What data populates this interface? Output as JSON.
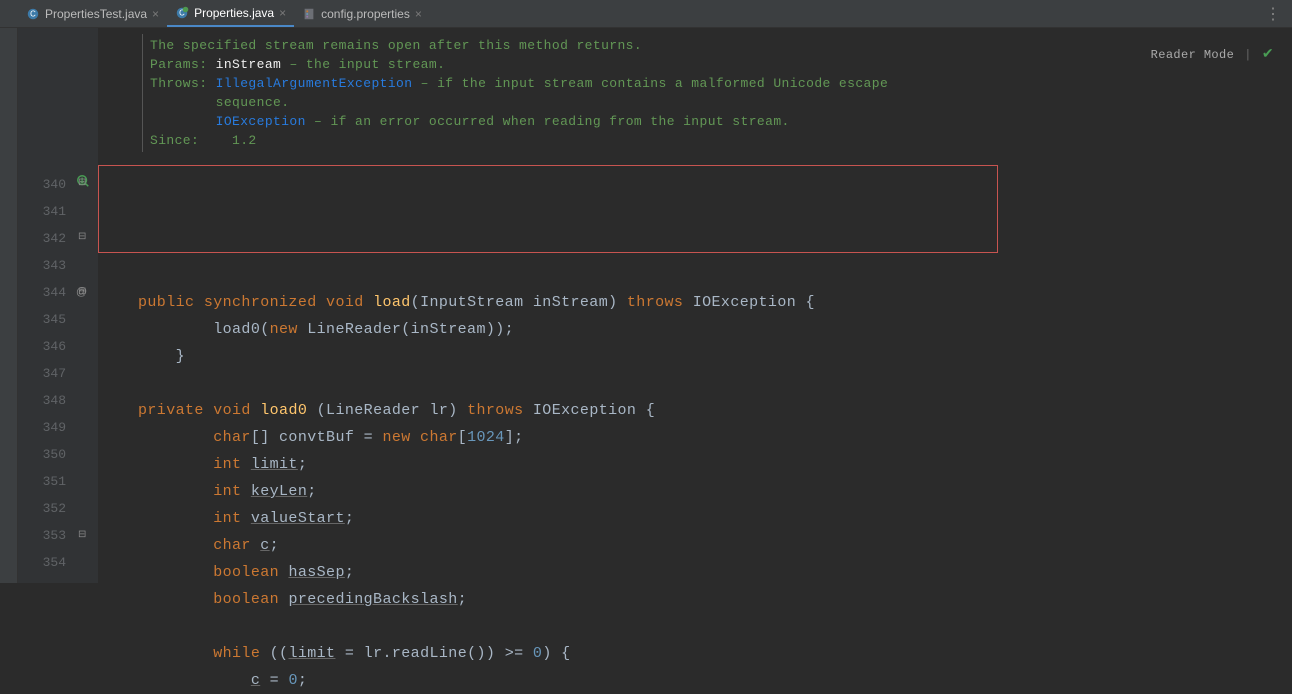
{
  "tabs": [
    {
      "label": "PropertiesTest.java",
      "active": false,
      "icon_color": "#5896b0"
    },
    {
      "label": "Properties.java",
      "active": true,
      "icon_color": "#5896b0"
    },
    {
      "label": "config.properties",
      "active": false,
      "icon_color": "#9876aa"
    }
  ],
  "reader_mode_label": "Reader Mode",
  "javadoc": {
    "desc": "The specified stream remains open after this method returns.",
    "params_label": "Params:",
    "params_value": "inStream",
    "params_desc": " – the input stream.",
    "throws_label": "Throws:",
    "throws_1_link": "IllegalArgumentException",
    "throws_1_desc": " – if the input stream contains a malformed Unicode escape",
    "throws_1_cont": "sequence.",
    "throws_2_link": "IOException",
    "throws_2_desc": " – if an error occurred when reading from the input stream.",
    "since_label": "Since:",
    "since_value": "1.2"
  },
  "line_numbers": [
    "340",
    "341",
    "342",
    "343",
    "344",
    "345",
    "346",
    "347",
    "348",
    "349",
    "350",
    "351",
    "352",
    "353",
    "354"
  ],
  "code": {
    "l340_kw1": "public ",
    "l340_kw2": "synchronized ",
    "l340_kw3": "void ",
    "l340_m": "load",
    "l340_sig": "(InputStream inStream) ",
    "l340_kw4": "throws ",
    "l340_type": "IOException {",
    "l341": "        load0(",
    "l341_kw": "new ",
    "l341_rest": "LineReader(inStream));",
    "l342": "    }",
    "l344_kw1": "private ",
    "l344_kw2": "void ",
    "l344_m": "load0 ",
    "l344_sig": "(LineReader lr) ",
    "l344_kw3": "throws ",
    "l344_type": "IOException {",
    "l345_kw": "char",
    "l345_a": "[] convtBuf = ",
    "l345_kw2": "new char",
    "l345_b": "[",
    "l345_num": "1024",
    "l345_c": "];",
    "l346_kw": "int ",
    "l346_v": "limit",
    "l346_s": ";",
    "l347_kw": "int ",
    "l347_v": "keyLen",
    "l347_s": ";",
    "l348_kw": "int ",
    "l348_v": "valueStart",
    "l348_s": ";",
    "l349_kw": "char ",
    "l349_v": "c",
    "l349_s": ";",
    "l350_kw": "boolean ",
    "l350_v": "hasSep",
    "l350_s": ";",
    "l351_kw": "boolean ",
    "l351_v": "precedingBackslash",
    "l351_s": ";",
    "l353_kw": "while ",
    "l353_a": "((",
    "l353_v": "limit",
    "l353_b": " = lr.readLine()) >= ",
    "l353_num": "0",
    "l353_c": ") {",
    "l354_v": "c",
    "l354_a": " = ",
    "l354_num": "0",
    "l354_b": ";"
  }
}
